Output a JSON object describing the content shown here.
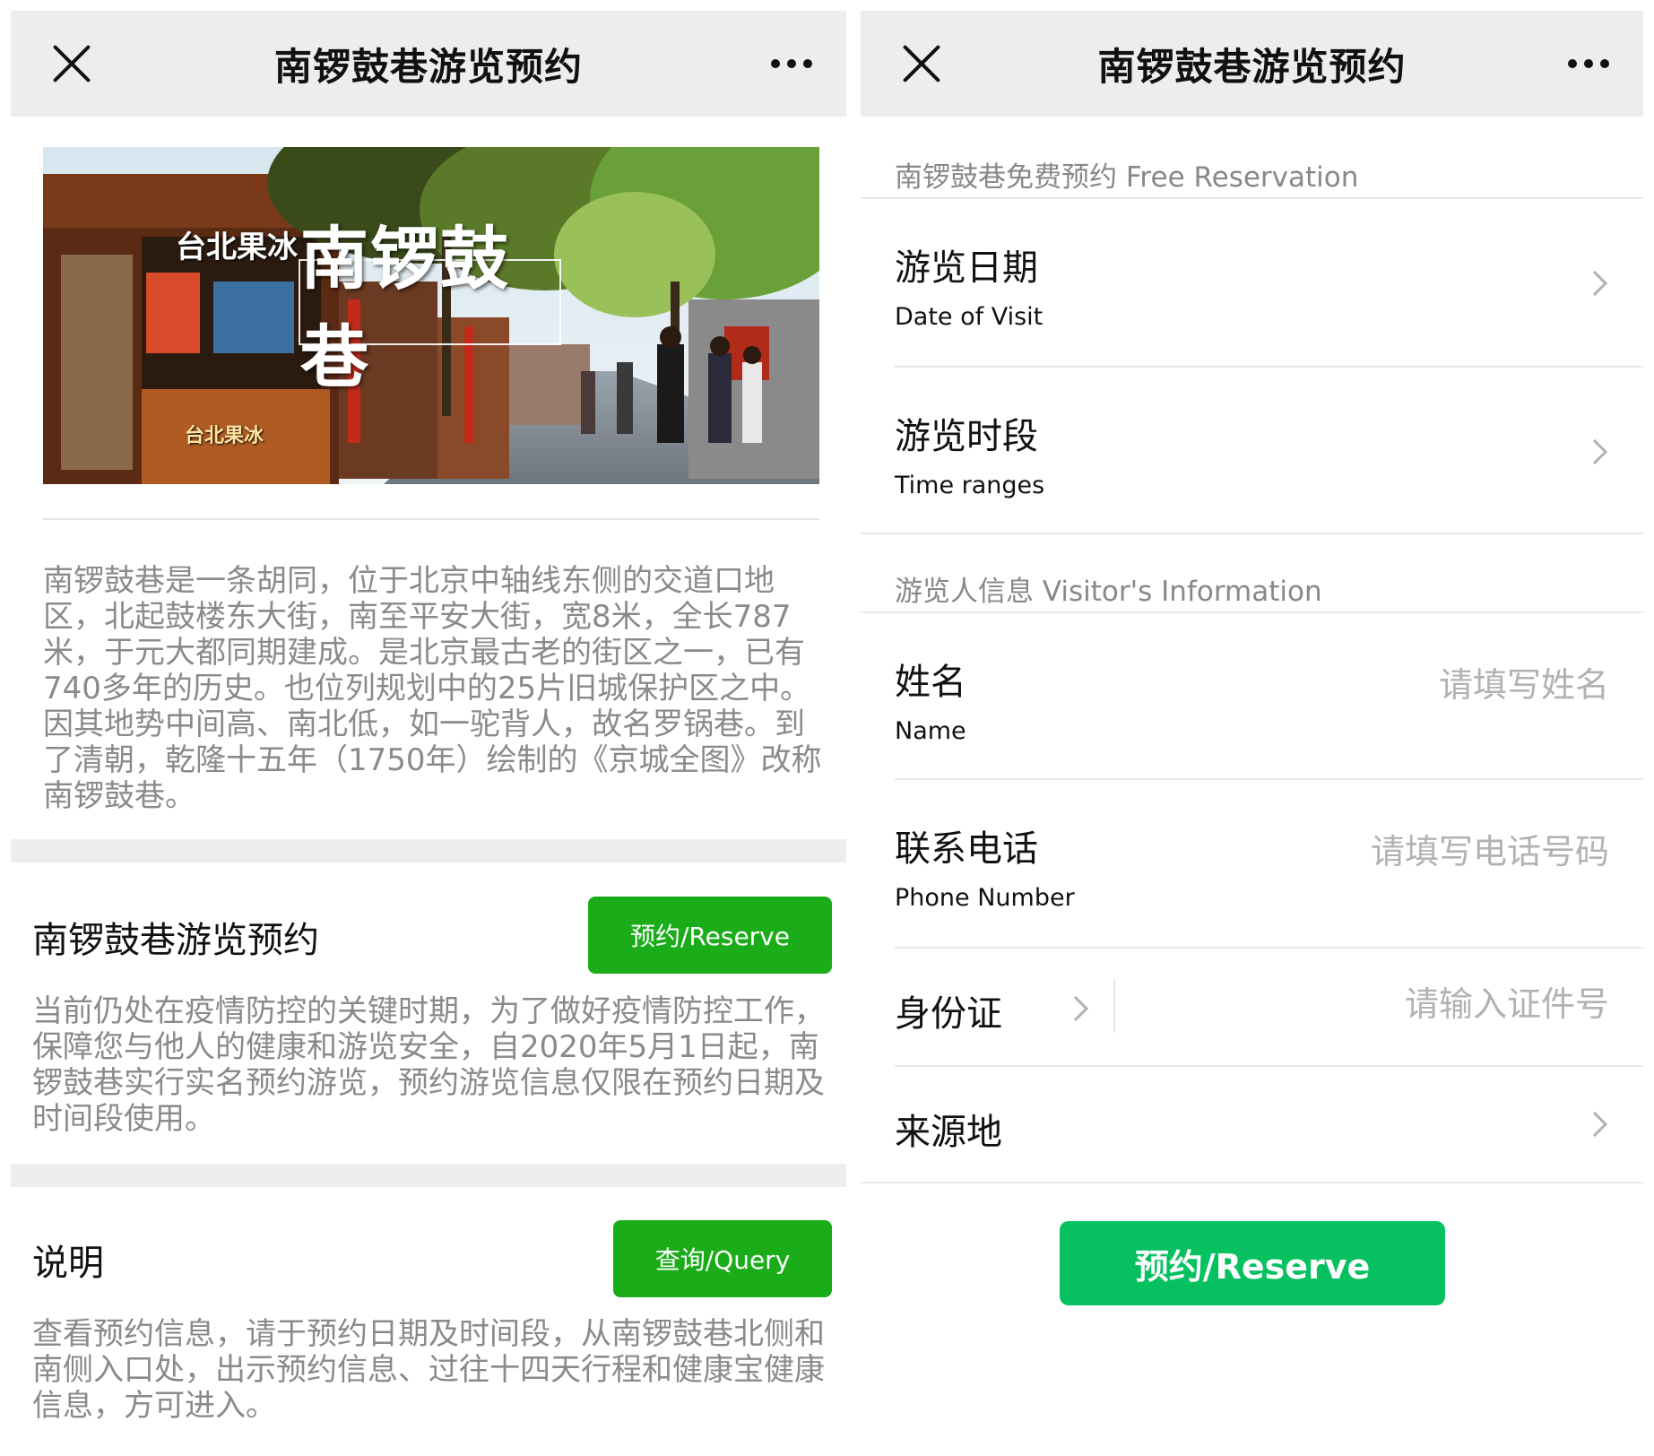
{
  "left": {
    "header": {
      "title": "南锣鼓巷游览预约"
    },
    "hero": {
      "title": "南锣鼓巷",
      "shop_sign": "台北果冰",
      "shop_sign_2": "台北果冰"
    },
    "intro": "南锣鼓巷是一条胡同，位于北京中轴线东侧的交道口地区，北起鼓楼东大街，南至平安大街，宽8米，全长787米，于元大都同期建成。是北京最古老的街区之一，已有740多年的历史。也位列规划中的25片旧城保护区之中。因其地势中间高、南北低，如一驼背人，故名罗锅巷。到了清朝，乾隆十五年（1750年）绘制的《京城全图》改称南锣鼓巷。",
    "reserve_section": {
      "title": "南锣鼓巷游览预约",
      "button": "预约/Reserve",
      "text": "当前仍处在疫情防控的关键时期，为了做好疫情防控工作，保障您与他人的健康和游览安全，自2020年5月1日起，南锣鼓巷实行实名预约游览，预约游览信息仅限在预约日期及时间段使用。"
    },
    "info_section": {
      "title": "说明",
      "button": "查询/Query",
      "text": "查看预约信息，请于预约日期及时间段，从南锣鼓巷北侧和南侧入口处，出示预约信息、过往十四天行程和健康宝健康信息，方可进入。"
    }
  },
  "right": {
    "header": {
      "title": "南锣鼓巷游览预约"
    },
    "group1": "南锣鼓巷免费预约 Free Reservation",
    "date": {
      "cn": "游览日期",
      "en": "Date of Visit"
    },
    "time": {
      "cn": "游览时段",
      "en": "Time ranges"
    },
    "group2": "游览人信息 Visitor's Information",
    "name": {
      "cn": "姓名",
      "en": "Name",
      "placeholder": "请填写姓名"
    },
    "phone": {
      "cn": "联系电话",
      "en": "Phone Number",
      "placeholder": "请填写电话号码"
    },
    "id": {
      "cn": "身份证",
      "placeholder": "请输入证件号"
    },
    "origin": {
      "cn": "来源地"
    },
    "reserve_button": "预约/Reserve"
  },
  "colors": {
    "wechat_green": "#1aad19",
    "reserve_green": "#07c160",
    "navbar_gray": "#ededed",
    "hint_gray": "#8a8a8a"
  }
}
